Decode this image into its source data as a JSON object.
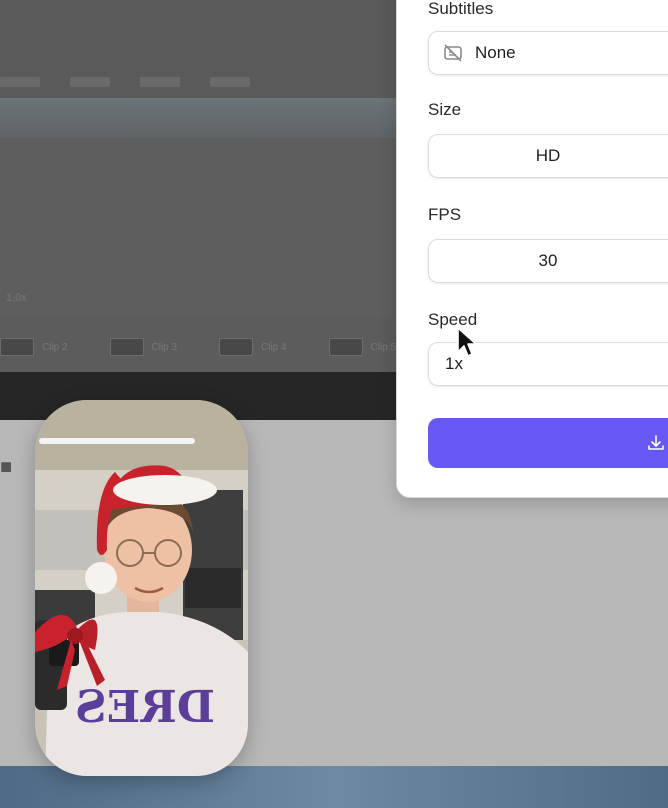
{
  "export_panel": {
    "subtitles": {
      "label": "Subtitles",
      "value": "None"
    },
    "size": {
      "label": "Size",
      "value": "HD"
    },
    "fps": {
      "label": "FPS",
      "value": "30"
    },
    "speed": {
      "label": "Speed",
      "value": "1x"
    },
    "export_button": {
      "icon": "download-icon"
    }
  },
  "background_editor": {
    "speed_readout": "1.0x",
    "clips": [
      "Clip 2",
      "Clip 3",
      "Clip 4",
      "Clip 5"
    ]
  },
  "webcam": {
    "shirt_text": "DRES"
  },
  "colors": {
    "accent": "#6757f5",
    "panel_bg": "#ffffff",
    "backdrop": "#b8b8b8"
  }
}
